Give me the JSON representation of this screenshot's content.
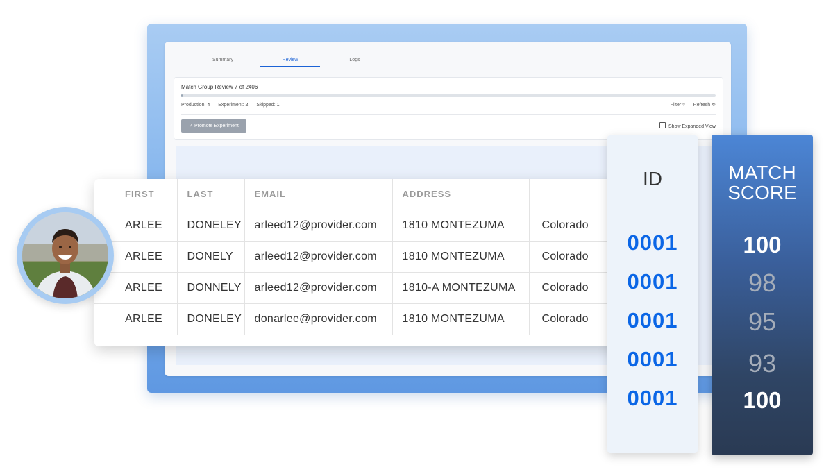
{
  "tabs": [
    {
      "label": "Summary"
    },
    {
      "label": "Review"
    },
    {
      "label": "Logs"
    }
  ],
  "active_tab": "Review",
  "review": {
    "title": "Match Group Review 7 of 2406",
    "progress": 0.003,
    "stats": {
      "production_label": "Production:",
      "production_value": "4",
      "experiment_label": "Experiment:",
      "experiment_value": "2",
      "skipped_label": "Skipped:",
      "skipped_value": "1"
    },
    "filter_label": "Filter",
    "refresh_label": "Refresh",
    "promote_label": "Promote Experiment",
    "expanded_view_label": "Show Expanded View",
    "expanded_view_checked": false
  },
  "table": {
    "headers": [
      "FIRST",
      "LAST",
      "EMAIL",
      "ADDRESS",
      ""
    ],
    "rows": [
      [
        "ARLEE",
        "DONELEY",
        "arleed12@provider.com",
        "1810 MONTEZUMA",
        "Colorado"
      ],
      [
        "ARLEE",
        "DONELY",
        "arleed12@provider.com",
        "1810 MONTEZUMA",
        "Colorado"
      ],
      [
        "ARLEE",
        "DONNELY",
        "arleed12@provider.com",
        "1810-A MONTEZUMA",
        "Colorado"
      ],
      [
        "ARLEE",
        "DONELEY",
        "donarlee@provider.com",
        "1810 MONTEZUMA",
        "Colorado"
      ]
    ]
  },
  "id_column": {
    "title": "ID",
    "values": [
      "0001",
      "0001",
      "0001",
      "0001",
      "0001"
    ]
  },
  "score_column": {
    "title_line1": "MATCH",
    "title_line2": "SCORE",
    "values": [
      "100",
      "98",
      "95",
      "93",
      "100"
    ]
  },
  "colors": {
    "accent": "#1c63d6",
    "id_blue": "#0b66e6",
    "score_top": "#4c86d6",
    "score_bottom": "#2a3a53"
  }
}
